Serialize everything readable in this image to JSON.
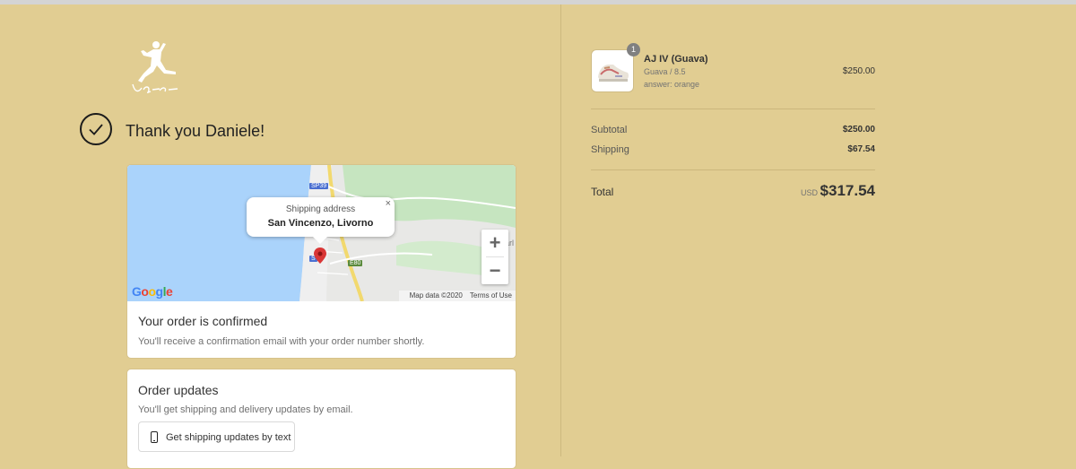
{
  "brand": {
    "logo_name": "jordan-jumpman-logo",
    "signature": "Ugo"
  },
  "header": {
    "thank_you": "Thank you Daniele!"
  },
  "map": {
    "popup_label": "Shipping address",
    "popup_address": "San Vincenzo, Livorno",
    "popup_close": "×",
    "road_labels": [
      "SP39",
      "S",
      "E80",
      "arl"
    ],
    "zoom_in": "+",
    "zoom_out": "−",
    "google_letters": [
      "G",
      "o",
      "o",
      "g",
      "l",
      "e"
    ],
    "map_data": "Map data ©2020",
    "terms": "Terms of Use",
    "colors": {
      "water": "#aad3fb",
      "land": "#e8e8e6",
      "park": "#c6e5c0",
      "highway": "#f2d96e"
    }
  },
  "confirmation": {
    "title": "Your order is confirmed",
    "text": "You'll receive a confirmation email with your order number shortly."
  },
  "updates": {
    "title": "Order updates",
    "text": "You'll get shipping and delivery updates by email.",
    "button": "Get shipping updates by text"
  },
  "product": {
    "name": "AJ IV (Guava)",
    "variant": "Guava / 8.5",
    "property": "answer: orange",
    "price": "$250.00",
    "quantity": "1"
  },
  "summary": {
    "subtotal_label": "Subtotal",
    "subtotal_value": "$250.00",
    "shipping_label": "Shipping",
    "shipping_value": "$67.54",
    "total_label": "Total",
    "currency": "USD",
    "total_value": "$317.54"
  },
  "colors": {
    "background": "#e1cd92",
    "card": "#ffffff",
    "accent_marker": "#d93636"
  }
}
